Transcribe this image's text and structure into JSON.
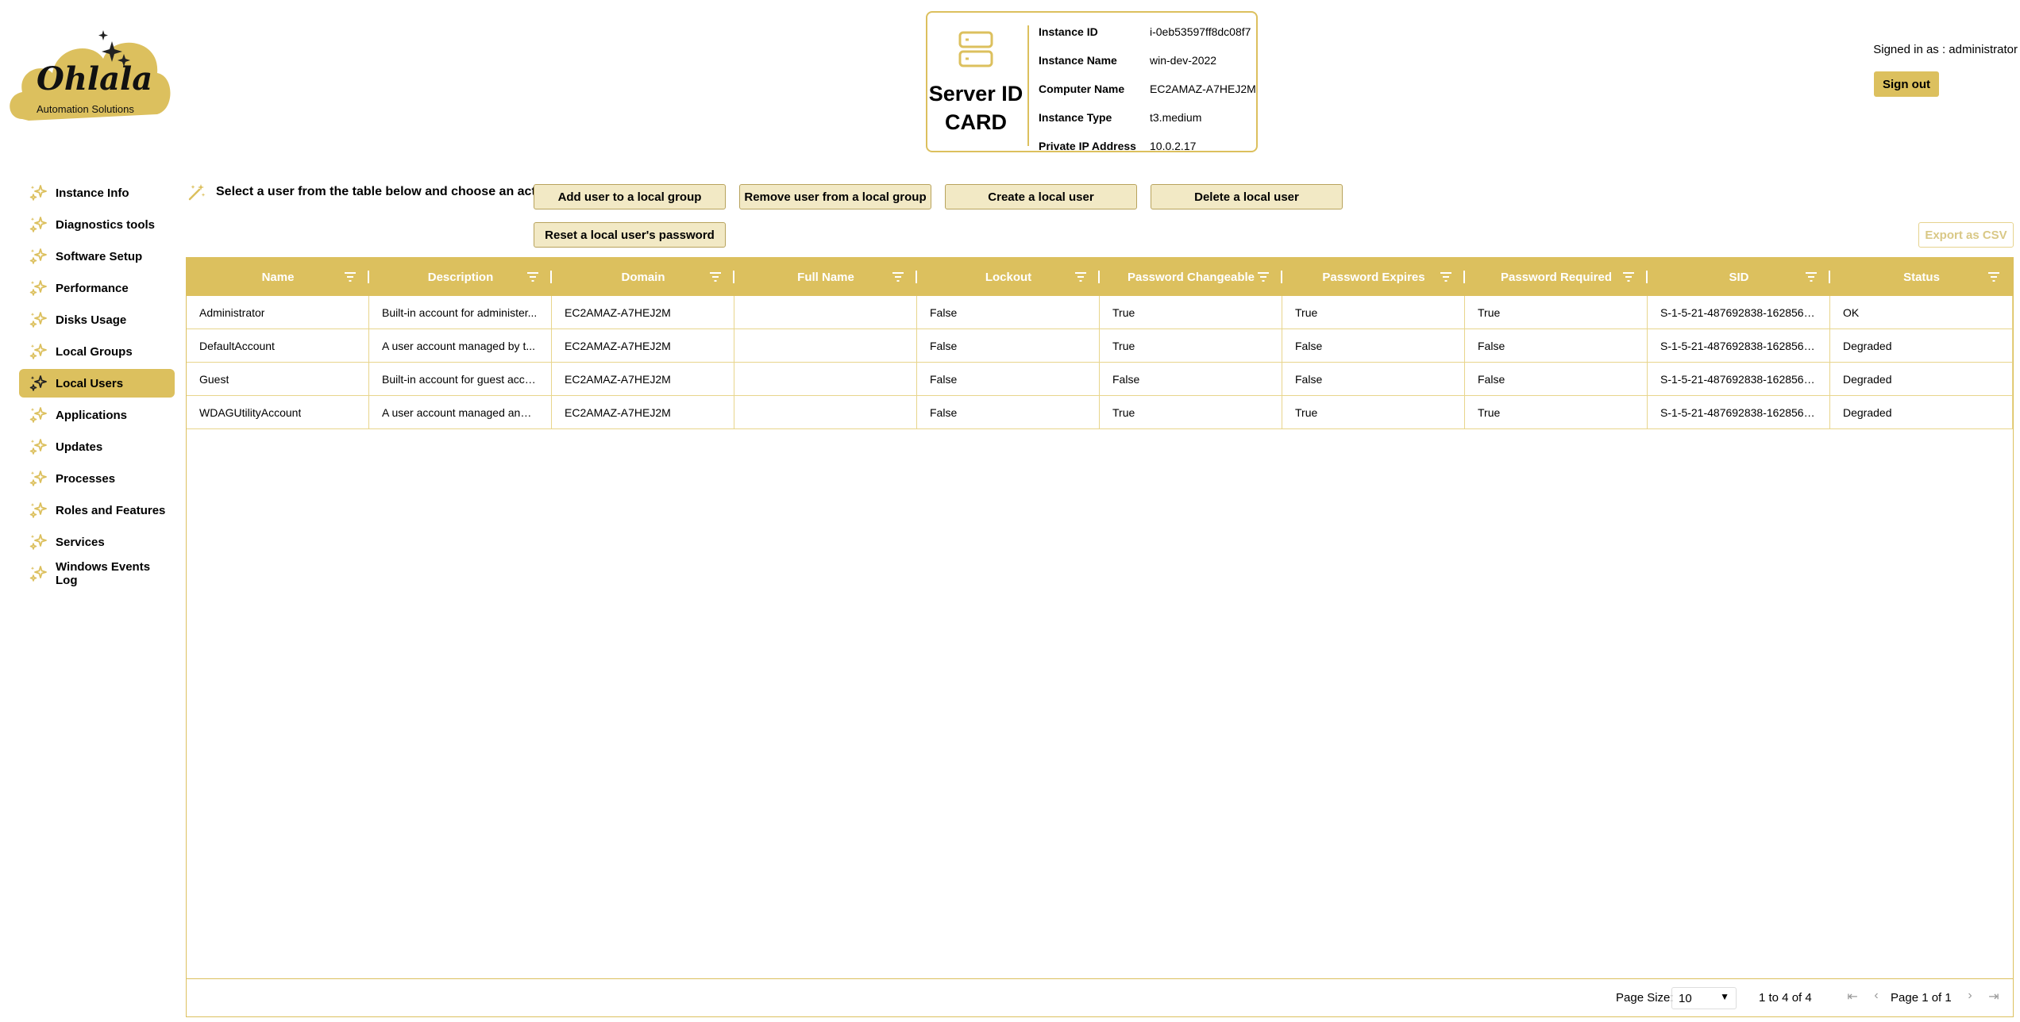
{
  "brand": {
    "name": "Ohlala",
    "tagline": "Automation Solutions"
  },
  "id_card": {
    "title_line1": "Server ID",
    "title_line2": "CARD",
    "fields": [
      {
        "label": "Instance ID",
        "value": "i-0eb53597ff8dc08f7"
      },
      {
        "label": "Instance Name",
        "value": "win-dev-2022"
      },
      {
        "label": "Computer Name",
        "value": "EC2AMAZ-A7HEJ2M"
      },
      {
        "label": "Instance Type",
        "value": "t3.medium"
      },
      {
        "label": "Private IP Address",
        "value": "10.0.2.17"
      }
    ]
  },
  "user": {
    "signed_in_text": "Signed in as : administrator",
    "sign_out_label": "Sign out"
  },
  "sidebar": {
    "items": [
      {
        "label": "Instance Info",
        "active": false
      },
      {
        "label": "Diagnostics tools",
        "active": false
      },
      {
        "label": "Software Setup",
        "active": false
      },
      {
        "label": "Performance",
        "active": false
      },
      {
        "label": "Disks Usage",
        "active": false
      },
      {
        "label": "Local Groups",
        "active": false
      },
      {
        "label": "Local Users",
        "active": true
      },
      {
        "label": "Applications",
        "active": false
      },
      {
        "label": "Updates",
        "active": false
      },
      {
        "label": "Processes",
        "active": false
      },
      {
        "label": "Roles and Features",
        "active": false
      },
      {
        "label": "Services",
        "active": false
      },
      {
        "label": "Windows Events Log",
        "active": false
      }
    ]
  },
  "toolbar": {
    "instruction": "Select a user from the table below and choose an action",
    "add_to_group": "Add user to a local group",
    "remove_from_group": "Remove user from a local group",
    "create_user": "Create a local user",
    "delete_user": "Delete a local user",
    "reset_password": "Reset a local user's password",
    "export_csv": "Export as CSV"
  },
  "table": {
    "columns": [
      "Name",
      "Description",
      "Domain",
      "Full Name",
      "Lockout",
      "Password Changeable",
      "Password Expires",
      "Password Required",
      "SID",
      "Status"
    ],
    "rows": [
      [
        "Administrator",
        "Built-in account for administer...",
        "EC2AMAZ-A7HEJ2M",
        "",
        "False",
        "True",
        "True",
        "True",
        "S-1-5-21-487692838-1628560...",
        "OK"
      ],
      [
        "DefaultAccount",
        "A user account managed by t...",
        "EC2AMAZ-A7HEJ2M",
        "",
        "False",
        "True",
        "False",
        "False",
        "S-1-5-21-487692838-1628560...",
        "Degraded"
      ],
      [
        "Guest",
        "Built-in account for guest acce...",
        "EC2AMAZ-A7HEJ2M",
        "",
        "False",
        "False",
        "False",
        "False",
        "S-1-5-21-487692838-1628560...",
        "Degraded"
      ],
      [
        "WDAGUtilityAccount",
        "A user account managed and ...",
        "EC2AMAZ-A7HEJ2M",
        "",
        "False",
        "True",
        "True",
        "True",
        "S-1-5-21-487692838-1628560...",
        "Degraded"
      ]
    ]
  },
  "pagination": {
    "page_size_label": "Page Size:",
    "page_size": "10",
    "row_count": "1 to 4 of 4",
    "page_indicator": "Page 1 of 1"
  },
  "colors": {
    "accent": "#dcc05e",
    "button_bg": "#f2e9c5",
    "border": "#e8d58c"
  }
}
